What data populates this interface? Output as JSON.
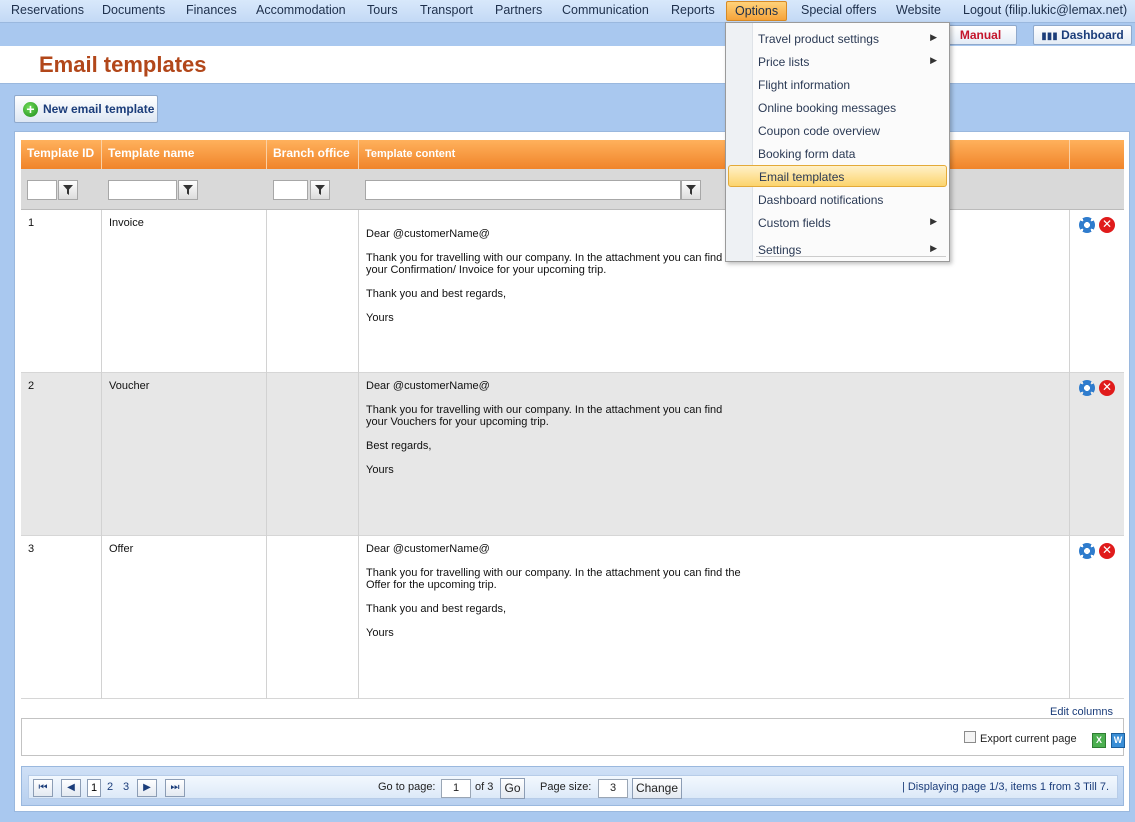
{
  "nav": {
    "items": [
      "Reservations",
      "Documents",
      "Finances",
      "Accommodation",
      "Tours",
      "Transport",
      "Partners",
      "Communication",
      "Reports",
      "Options",
      "Special offers",
      "Website",
      "Logout (filip.lukic@lemax.net)"
    ],
    "active": "Options"
  },
  "header": {
    "title": "Email templates",
    "manual_label": "Manual",
    "dashboard_label": "Dashboard"
  },
  "toolbar": {
    "new_template_label": "New email template"
  },
  "grid": {
    "columns": [
      "Template ID",
      "Template name",
      "Branch office",
      "Template content"
    ],
    "rows": [
      {
        "id": "1",
        "name": "Invoice",
        "branch": "",
        "content": [
          "Dear @customerName@",
          "Thank you for travelling with our company. In the attachment you can find your Confirmation/ Invoice for your upcoming trip.",
          "Thank you and best regards,",
          "Yours"
        ]
      },
      {
        "id": "2",
        "name": "Voucher",
        "branch": "",
        "content": [
          "Dear @customerName@",
          "Thank you for travelling with our company. In the attachment you can find your Vouchers for your upcoming trip.",
          "Best regards,",
          "Yours"
        ]
      },
      {
        "id": "3",
        "name": "Offer",
        "branch": "",
        "content": [
          "Dear @customerName@",
          "Thank you for travelling with our company. In the attachment you can find the Offer for the upcoming trip.",
          "Thank you and best regards,",
          "Yours"
        ]
      }
    ],
    "edit_columns_label": "Edit columns",
    "export_label": "Export current page"
  },
  "pager": {
    "first": "⏮",
    "prev": "◀",
    "next": "▶",
    "last": "⏭",
    "pages": [
      "1",
      "2",
      "3"
    ],
    "current_page": "1",
    "go_to_label": "Go to page:",
    "go_value": "1",
    "of_label": "of 3",
    "go_button": "Go",
    "page_size_label": "Page size:",
    "page_size_value": "3",
    "change_button": "Change",
    "info": "| Displaying page  1/3,  items  1  from  3  Till  7."
  },
  "options_menu": {
    "items": [
      {
        "label": "Travel product settings",
        "submenu": true
      },
      {
        "label": "Price lists",
        "submenu": true
      },
      {
        "label": "Flight information",
        "submenu": false
      },
      {
        "label": "Online booking messages",
        "submenu": false
      },
      {
        "label": "Coupon code overview",
        "submenu": false
      },
      {
        "label": "Booking form data",
        "submenu": false
      },
      {
        "label": "Email templates",
        "submenu": false
      },
      {
        "label": "Dashboard notifications",
        "submenu": false
      },
      {
        "label": "Custom fields",
        "submenu": true
      },
      {
        "label": "Settings",
        "submenu": true
      }
    ],
    "selected": "Email templates"
  },
  "colors": {
    "accent_orange": "#f0842a",
    "title_brown": "#b2471a",
    "nav_blue": "#c3d9f5"
  },
  "icons": [
    "filter-icon",
    "gear-icon",
    "delete-icon",
    "plus-icon",
    "excel-export-icon",
    "dashboard-icon",
    "chevron-right-icon"
  ]
}
